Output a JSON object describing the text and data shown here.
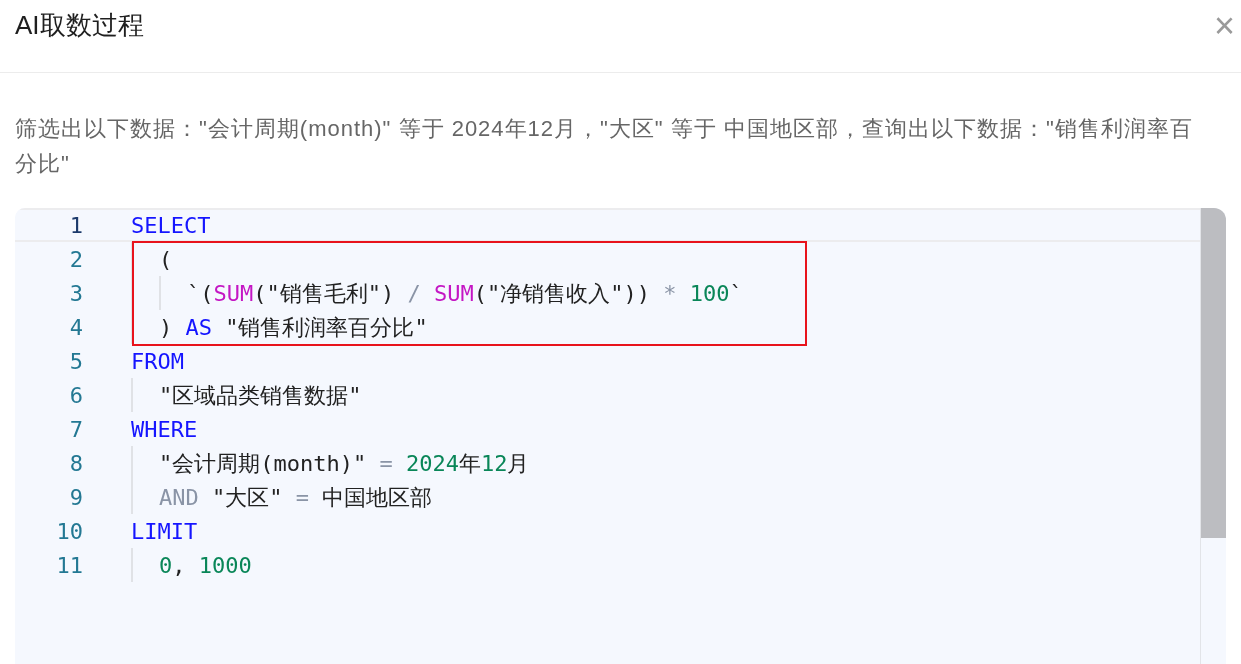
{
  "dialog": {
    "title": "AI取数过程",
    "close": "×"
  },
  "description": "筛选出以下数据：\"会计周期(month)\" 等于 2024年12月，\"大区\" 等于 中国地区部，查询出以下数据：\"销售利润率百分比\"",
  "code": {
    "lines": [
      {
        "number": "1",
        "active": true,
        "highlighted": true,
        "tokens": [
          {
            "kind": "keyword",
            "text": "SELECT"
          }
        ],
        "children": [
          {
            "number": "2",
            "active": false,
            "tokens": [
              {
                "kind": "plain",
                "text": "("
              }
            ],
            "children": [
              {
                "number": "3",
                "active": false,
                "tokens": [
                  {
                    "kind": "plain",
                    "text": "`("
                  },
                  {
                    "kind": "function",
                    "text": "SUM"
                  },
                  {
                    "kind": "plain",
                    "text": "(\"销售毛利\") "
                  },
                  {
                    "kind": "operator",
                    "text": "/ "
                  },
                  {
                    "kind": "function",
                    "text": "SUM"
                  },
                  {
                    "kind": "plain",
                    "text": "(\"净销售收入\")) "
                  },
                  {
                    "kind": "operator",
                    "text": "* "
                  },
                  {
                    "kind": "number",
                    "text": "100"
                  },
                  {
                    "kind": "plain",
                    "text": "`"
                  }
                ]
              }
            ]
          },
          {
            "number": "4",
            "active": false,
            "tokens": [
              {
                "kind": "plain",
                "text": ") "
              },
              {
                "kind": "keyword",
                "text": "AS"
              },
              {
                "kind": "plain",
                "text": " \"销售利润率百分比\""
              }
            ]
          }
        ]
      },
      {
        "number": "5",
        "active": false,
        "highlighted": false,
        "tokens": [
          {
            "kind": "keyword",
            "text": "FROM"
          }
        ],
        "children": [
          {
            "number": "6",
            "active": false,
            "tokens": [
              {
                "kind": "plain",
                "text": "\"区域品类销售数据\""
              }
            ]
          }
        ]
      },
      {
        "number": "7",
        "active": false,
        "highlighted": false,
        "tokens": [
          {
            "kind": "keyword",
            "text": "WHERE"
          }
        ],
        "children": [
          {
            "number": "8",
            "active": false,
            "tokens": [
              {
                "kind": "plain",
                "text": "\"会计周期(month)\" "
              },
              {
                "kind": "operator",
                "text": "= "
              },
              {
                "kind": "number",
                "text": "2024"
              },
              {
                "kind": "plain",
                "text": "年"
              },
              {
                "kind": "number",
                "text": "12"
              },
              {
                "kind": "plain",
                "text": "月"
              }
            ]
          },
          {
            "number": "9",
            "active": false,
            "tokens": [
              {
                "kind": "muted",
                "text": "AND"
              },
              {
                "kind": "plain",
                "text": " \"大区\" "
              },
              {
                "kind": "operator",
                "text": "="
              },
              {
                "kind": "plain",
                "text": " 中国地区部"
              }
            ]
          }
        ]
      },
      {
        "number": "10",
        "active": false,
        "highlighted": false,
        "tokens": [
          {
            "kind": "keyword",
            "text": "LIMIT"
          }
        ],
        "children": [
          {
            "number": "11",
            "active": false,
            "tokens": [
              {
                "kind": "number",
                "text": "0"
              },
              {
                "kind": "plain",
                "text": ", "
              },
              {
                "kind": "number",
                "text": "1000"
              }
            ]
          }
        ]
      }
    ]
  }
}
